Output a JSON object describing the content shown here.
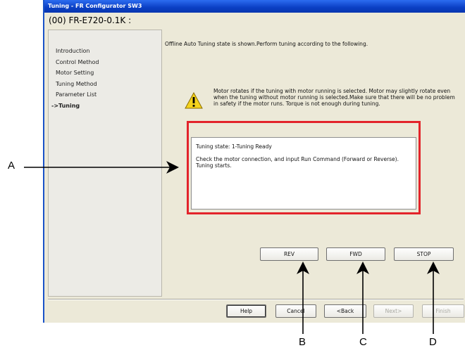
{
  "window": {
    "title": "Tuning - FR Configurator SW3"
  },
  "device_title": "(00) FR-E720-0.1K :",
  "steps": [
    {
      "label": "Introduction"
    },
    {
      "label": "Control Method"
    },
    {
      "label": "Motor Setting"
    },
    {
      "label": "Tuning Method"
    },
    {
      "label": "Parameter List"
    },
    {
      "label": "->Tuning"
    }
  ],
  "instruction": "Offline Auto Tuning state is shown.Perform tuning according to the following.",
  "warning": {
    "icon": "warning-icon",
    "text": "Motor rotates if the tuning with motor running is selected. Motor may slightly rotate even when the tuning without motor running is selected.Make sure that there will be no problem in safety if the motor runs. Torque is not enough during tuning."
  },
  "status": {
    "state": "Tuning state: 1-Tuning Ready",
    "message": "Check the motor connection, and input Run Command (Forward or Reverse). Tuning starts."
  },
  "run_buttons": {
    "rev": "REV",
    "fwd": "FWD",
    "stop": "STOP"
  },
  "nav_buttons": {
    "help": "Help",
    "cancel": "Cancel",
    "back": "<Back",
    "next": "Next>",
    "finish": "Finish"
  },
  "callouts": {
    "a": "A",
    "b": "B",
    "c": "C",
    "d": "D"
  },
  "colors": {
    "title_bar": "#0a3fc4",
    "highlight": "#e3242b",
    "dialog_bg": "#ece9d8",
    "warning_yellow": "#f5d31c"
  }
}
